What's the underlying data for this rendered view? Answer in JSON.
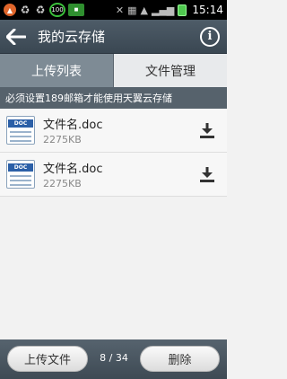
{
  "statusbar": {
    "icons": [
      "shield-icon",
      "recycle-icon",
      "battery-saver-icon",
      "app-icon",
      "mute-icon",
      "vibrate-icon",
      "wifi-icon",
      "signal-icon",
      "battery-icon"
    ],
    "badge_100": "100",
    "time": "15:14"
  },
  "header": {
    "title": "我的云存储"
  },
  "tabs": [
    {
      "label": "上传列表",
      "active": false
    },
    {
      "label": "文件管理",
      "active": true
    }
  ],
  "notice": "必须设置189邮箱才能使用天翼云存储",
  "files": [
    {
      "name": "文件名.doc",
      "size": "2275KB",
      "icon_text": "DOC"
    },
    {
      "name": "文件名.doc",
      "size": "2275KB",
      "icon_text": "DOC"
    }
  ],
  "bottom": {
    "upload_label": "上传文件",
    "page_indicator": "8 / 34",
    "delete_label": "删除"
  },
  "colors": {
    "title_bar": "#46535e",
    "tab_inactive": "#7e8b95",
    "tab_active": "#e8eaec",
    "notice_bar": "#56626c",
    "doc_icon_blue": "#2b5fa7"
  }
}
